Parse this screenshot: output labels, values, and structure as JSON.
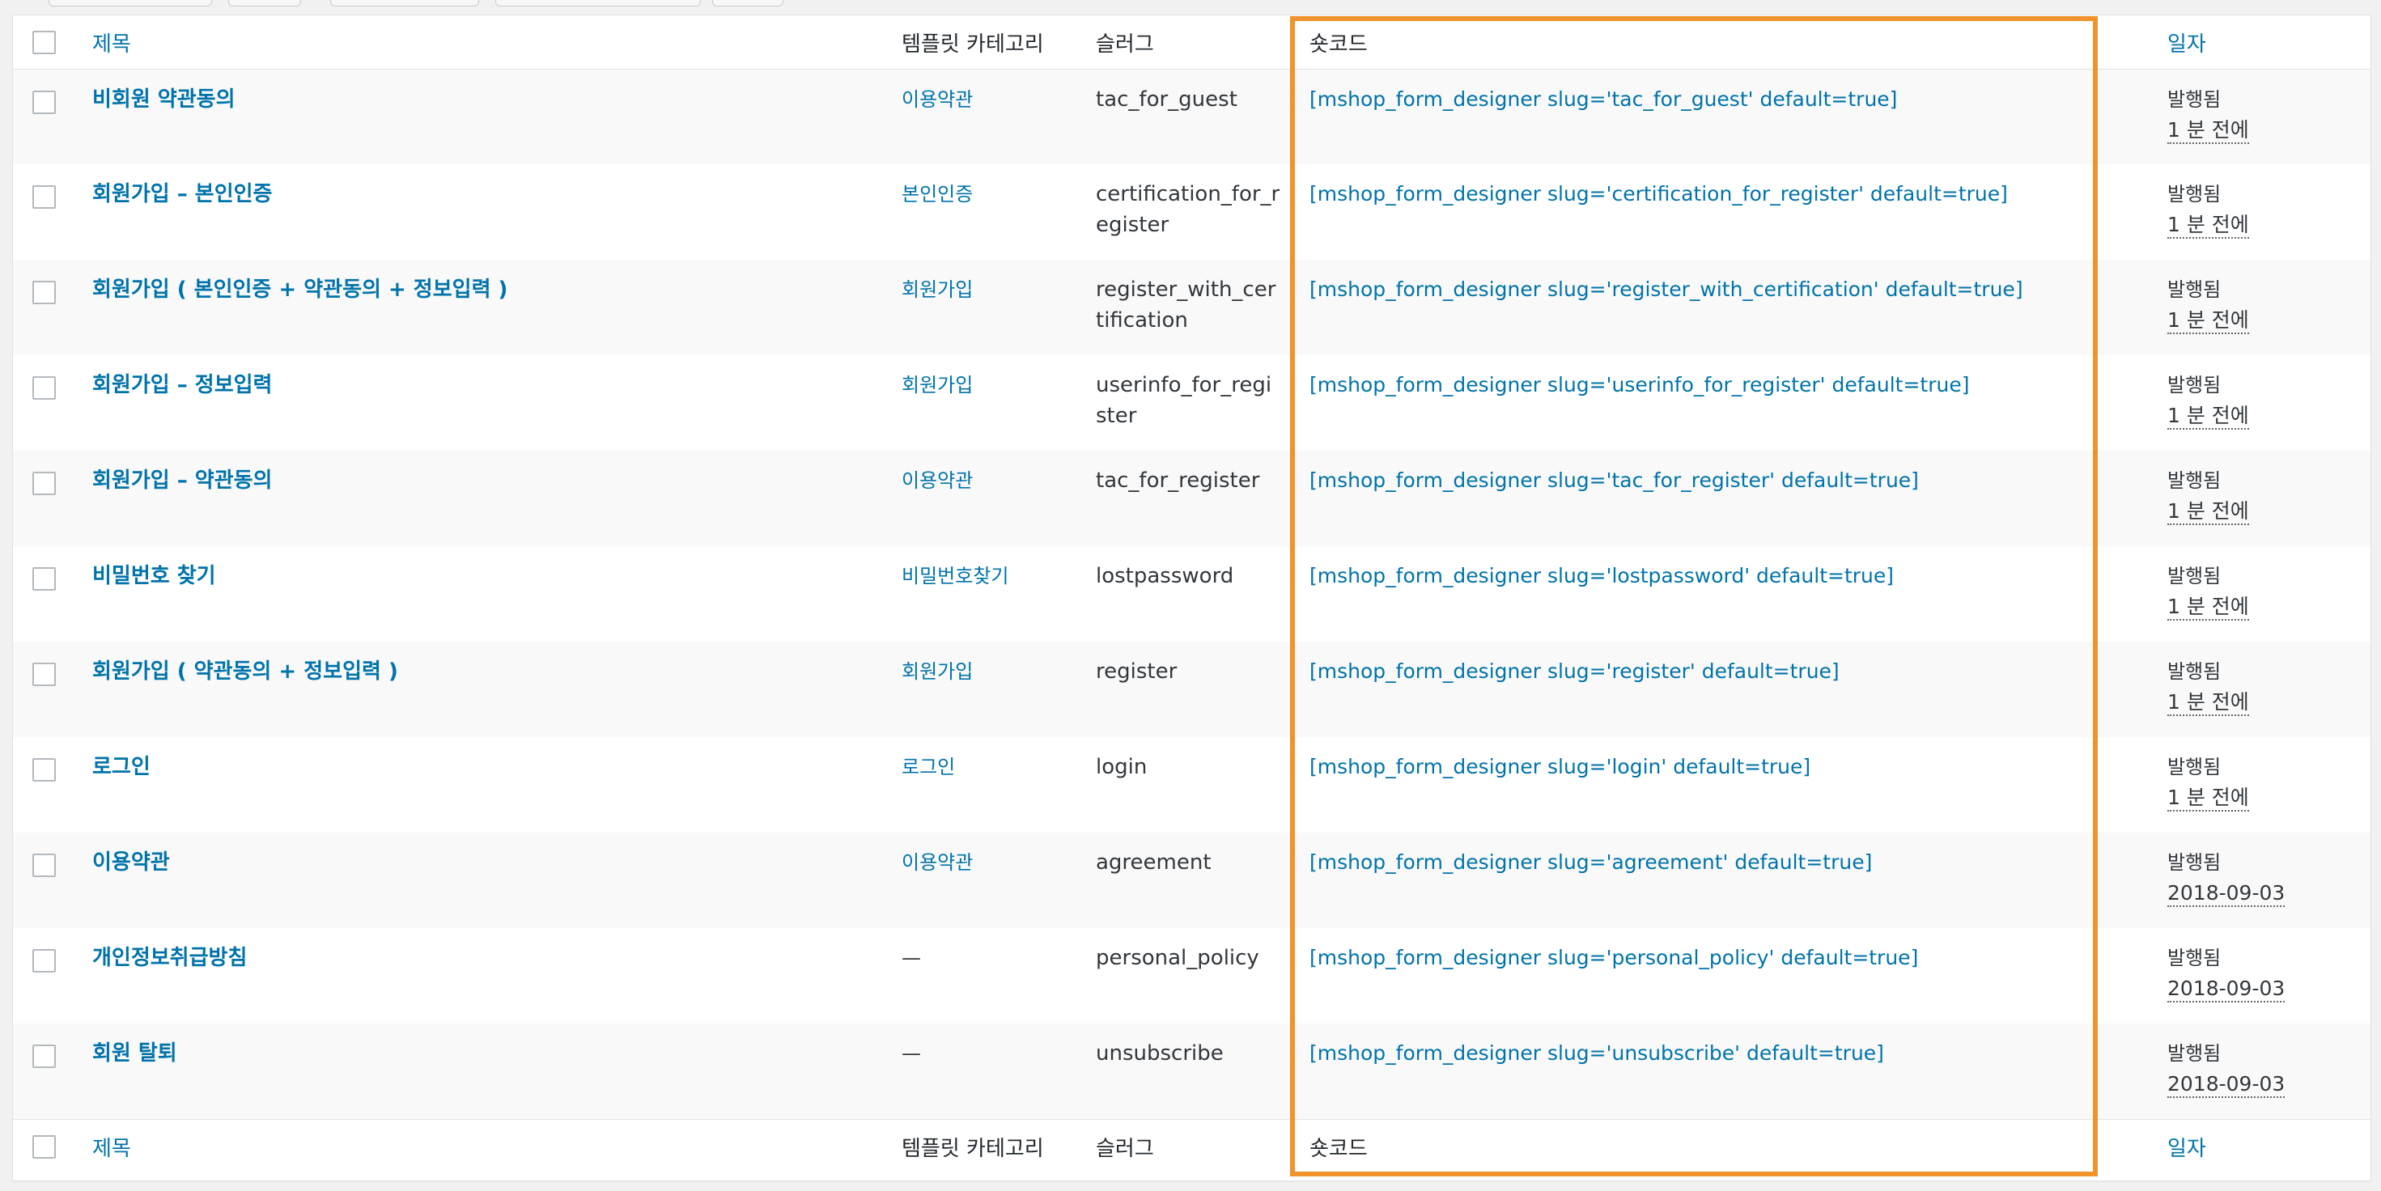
{
  "columns": {
    "title": "제목",
    "category": "템플릿 카테고리",
    "slug": "슬러그",
    "shortcode": "숏코드",
    "date": "일자"
  },
  "rows": [
    {
      "title": "비회원 약관동의",
      "category": "이용약관",
      "slug": "tac_for_guest",
      "shortcode": "[mshop_form_designer slug='tac_for_guest' default=true]",
      "status": "발행됨",
      "date": "1 분 전에"
    },
    {
      "title": "회원가입 – 본인인증",
      "category": "본인인증",
      "slug": "certification_for_register",
      "shortcode": "[mshop_form_designer slug='certification_for_register' default=true]",
      "status": "발행됨",
      "date": "1 분 전에"
    },
    {
      "title": "회원가입 ( 본인인증 + 약관동의 + 정보입력 )",
      "category": "회원가입",
      "slug": "register_with_certification",
      "shortcode": "[mshop_form_designer slug='register_with_certification' default=true]",
      "status": "발행됨",
      "date": "1 분 전에"
    },
    {
      "title": "회원가입 – 정보입력",
      "category": "회원가입",
      "slug": "userinfo_for_register",
      "shortcode": "[mshop_form_designer slug='userinfo_for_register' default=true]",
      "status": "발행됨",
      "date": "1 분 전에"
    },
    {
      "title": "회원가입 – 약관동의",
      "category": "이용약관",
      "slug": "tac_for_register",
      "shortcode": "[mshop_form_designer slug='tac_for_register' default=true]",
      "status": "발행됨",
      "date": "1 분 전에"
    },
    {
      "title": "비밀번호 찾기",
      "category": "비밀번호찾기",
      "slug": "lostpassword",
      "shortcode": "[mshop_form_designer slug='lostpassword' default=true]",
      "status": "발행됨",
      "date": "1 분 전에"
    },
    {
      "title": "회원가입 ( 약관동의 + 정보입력 )",
      "category": "회원가입",
      "slug": "register",
      "shortcode": "[mshop_form_designer slug='register' default=true]",
      "status": "발행됨",
      "date": "1 분 전에"
    },
    {
      "title": "로그인",
      "category": "로그인",
      "slug": "login",
      "shortcode": "[mshop_form_designer slug='login' default=true]",
      "status": "발행됨",
      "date": "1 분 전에"
    },
    {
      "title": "이용약관",
      "category": "이용약관",
      "slug": "agreement",
      "shortcode": "[mshop_form_designer slug='agreement' default=true]",
      "status": "발행됨",
      "date": "2018-09-03"
    },
    {
      "title": "개인정보취급방침",
      "category": "—",
      "slug": "personal_policy",
      "shortcode": "[mshop_form_designer slug='personal_policy' default=true]",
      "status": "발행됨",
      "date": "2018-09-03"
    },
    {
      "title": "회원 탈퇴",
      "category": "—",
      "slug": "unsubscribe",
      "shortcode": "[mshop_form_designer slug='unsubscribe' default=true]",
      "status": "발행됨",
      "date": "2018-09-03"
    }
  ],
  "colors": {
    "link": "#0073aa",
    "highlight": "#f0932b",
    "stripe": "#f9f9f9"
  }
}
